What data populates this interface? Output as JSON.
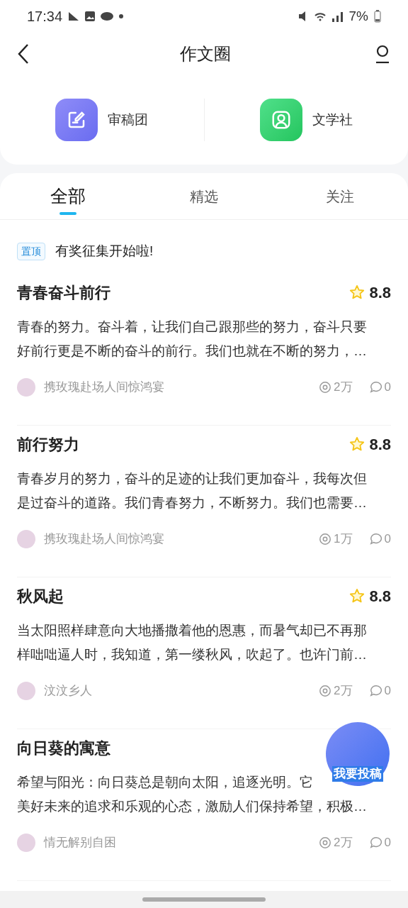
{
  "status_bar": {
    "time": "17:34",
    "battery": "7%"
  },
  "header": {
    "title": "作文圈"
  },
  "shortcuts": [
    {
      "kind": "review",
      "label": "审稿团"
    },
    {
      "kind": "club",
      "label": "文学社"
    }
  ],
  "tabs": [
    {
      "label": "全部",
      "selected": true
    },
    {
      "label": "精选",
      "selected": false
    },
    {
      "label": "关注",
      "selected": false
    }
  ],
  "pinned": {
    "badge": "置顶",
    "text": "有奖征集开始啦!"
  },
  "posts": [
    {
      "title": "青春奋斗前行",
      "score": "8.8",
      "lines": [
        "青春的努力。奋斗着，让我们自己跟那些的努力，奋斗只要",
        "好前行更是不断的奋斗的前行。我们也就在不断的努力，…"
      ],
      "author": "携玫瑰赴场人间惊鸿宴",
      "views": "2万",
      "comments": "0"
    },
    {
      "title": "前行努力",
      "score": "8.8",
      "lines": [
        "青春岁月的努力，奋斗的足迹的让我们更加奋斗，我每次但",
        "是过奋斗的道路。我们青春努力，不断努力。我们也需要…"
      ],
      "author": "携玫瑰赴场人间惊鸿宴",
      "views": "1万",
      "comments": "0"
    },
    {
      "title": "秋风起",
      "score": "8.8",
      "lines": [
        "当太阳照样肆意向大地播撒着他的恩惠，而暑气却已不再那",
        "样咄咄逼人时，我知道，第一缕秋风，吹起了。也许门前…"
      ],
      "author": "汶汶乡人",
      "views": "2万",
      "comments": "0"
    },
    {
      "title": "向日葵的寓意",
      "lines": [
        "希望与阳光：向日葵总是朝向太阳，追逐光明。它",
        "美好未来的追求和乐观的心态，激励人们保持希望，积极…"
      ],
      "author": "情无解别自困",
      "views": "2万",
      "comments": "0"
    }
  ],
  "fab": {
    "label": "我要投稿"
  }
}
